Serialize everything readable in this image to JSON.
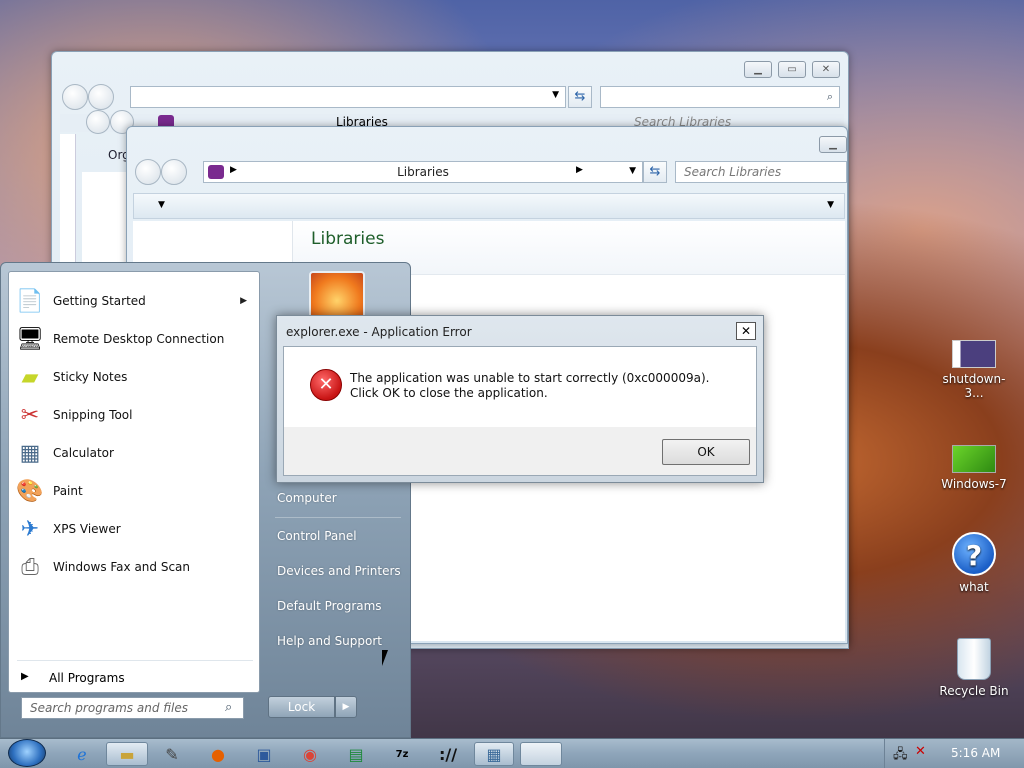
{
  "explorer_back": {
    "address_label": "Libraries",
    "search_placeholder": "Search Libraries",
    "toolbar_partial_label": "Org"
  },
  "explorer_front": {
    "address_label": "Libraries",
    "search_placeholder": "Search Libraries",
    "heading": "Libraries"
  },
  "start_menu": {
    "programs": [
      {
        "label": "Getting Started",
        "icon": "getting-started-icon",
        "has_submenu": true
      },
      {
        "label": "Remote Desktop Connection",
        "icon": "remote-desktop-icon"
      },
      {
        "label": "Sticky Notes",
        "icon": "sticky-notes-icon"
      },
      {
        "label": "Snipping Tool",
        "icon": "snipping-tool-icon"
      },
      {
        "label": "Calculator",
        "icon": "calculator-icon"
      },
      {
        "label": "Paint",
        "icon": "paint-icon"
      },
      {
        "label": "XPS Viewer",
        "icon": "xps-viewer-icon"
      },
      {
        "label": "Windows Fax and Scan",
        "icon": "fax-scan-icon"
      }
    ],
    "all_programs": "All Programs",
    "search_placeholder": "Search programs and files",
    "right_items": [
      "Computer",
      "Control Panel",
      "Devices and Printers",
      "Default Programs",
      "Help and Support"
    ],
    "lock_label": "Lock"
  },
  "dialog": {
    "title": "explorer.exe - Application Error",
    "message": "The application was unable to start correctly (0xc000009a). Click OK to close the application.",
    "ok_label": "OK",
    "close_glyph": "✕"
  },
  "desktop_icons": [
    {
      "label": "shutdown-3..."
    },
    {
      "label": "Windows-7"
    },
    {
      "label": "what"
    },
    {
      "label": "Recycle Bin"
    }
  ],
  "taskbar": {
    "clock": "5:16 AM"
  }
}
